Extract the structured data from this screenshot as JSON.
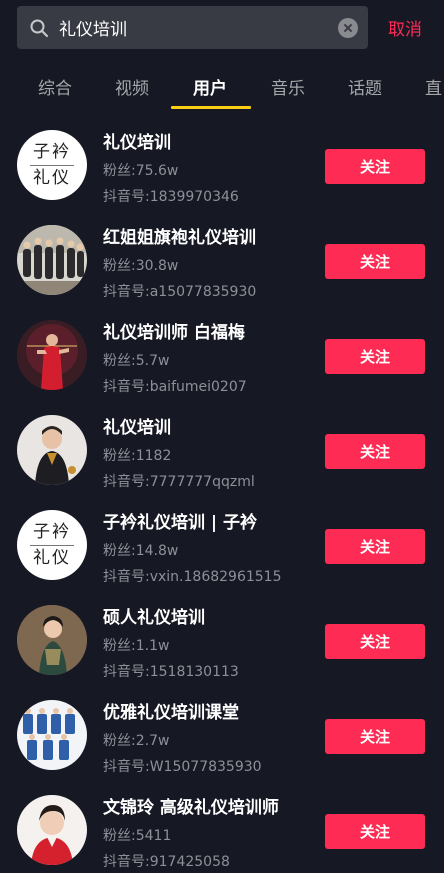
{
  "search": {
    "query": "礼仪培训",
    "cancel_label": "取消"
  },
  "tabs": [
    {
      "label": "综合"
    },
    {
      "label": "视频"
    },
    {
      "label": "用户"
    },
    {
      "label": "音乐"
    },
    {
      "label": "话题"
    },
    {
      "label": "直"
    }
  ],
  "active_tab": "用户",
  "follow_label": "关注",
  "users": [
    {
      "name": "礼仪培训",
      "fans": "粉丝:75.6w",
      "uid": "抖音号:1839970346",
      "avatar": "logo"
    },
    {
      "name": "红姐姐旗袍礼仪培训",
      "fans": "粉丝:30.8w",
      "uid": "抖音号:a15077835930",
      "avatar": "group"
    },
    {
      "name": "礼仪培训师 白福梅",
      "fans": "粉丝:5.7w",
      "uid": "抖音号:baifumei0207",
      "avatar": "red-dress"
    },
    {
      "name": "礼仪培训",
      "fans": "粉丝:1182",
      "uid": "抖音号:7777777qqzml",
      "avatar": "portrait"
    },
    {
      "name": "子衿礼仪培训 | 子衿",
      "fans": "粉丝:14.8w",
      "uid": "抖音号:vxin.18682961515",
      "avatar": "logo"
    },
    {
      "name": "硕人礼仪培训",
      "fans": "粉丝:1.1w",
      "uid": "抖音号:1518130113",
      "avatar": "qipao"
    },
    {
      "name": "优雅礼仪培训课堂",
      "fans": "粉丝:2.7w",
      "uid": "抖音号:W15077835930",
      "avatar": "class"
    },
    {
      "name": "文锦玲 高级礼仪培训师",
      "fans": "粉丝:5411",
      "uid": "抖音号:917425058",
      "avatar": "red-portrait"
    }
  ],
  "logo_text": {
    "top": "子衿",
    "bottom": "礼仪"
  },
  "colors": {
    "accent": "#fe2c55",
    "indicator": "#face15",
    "background": "#161823"
  }
}
